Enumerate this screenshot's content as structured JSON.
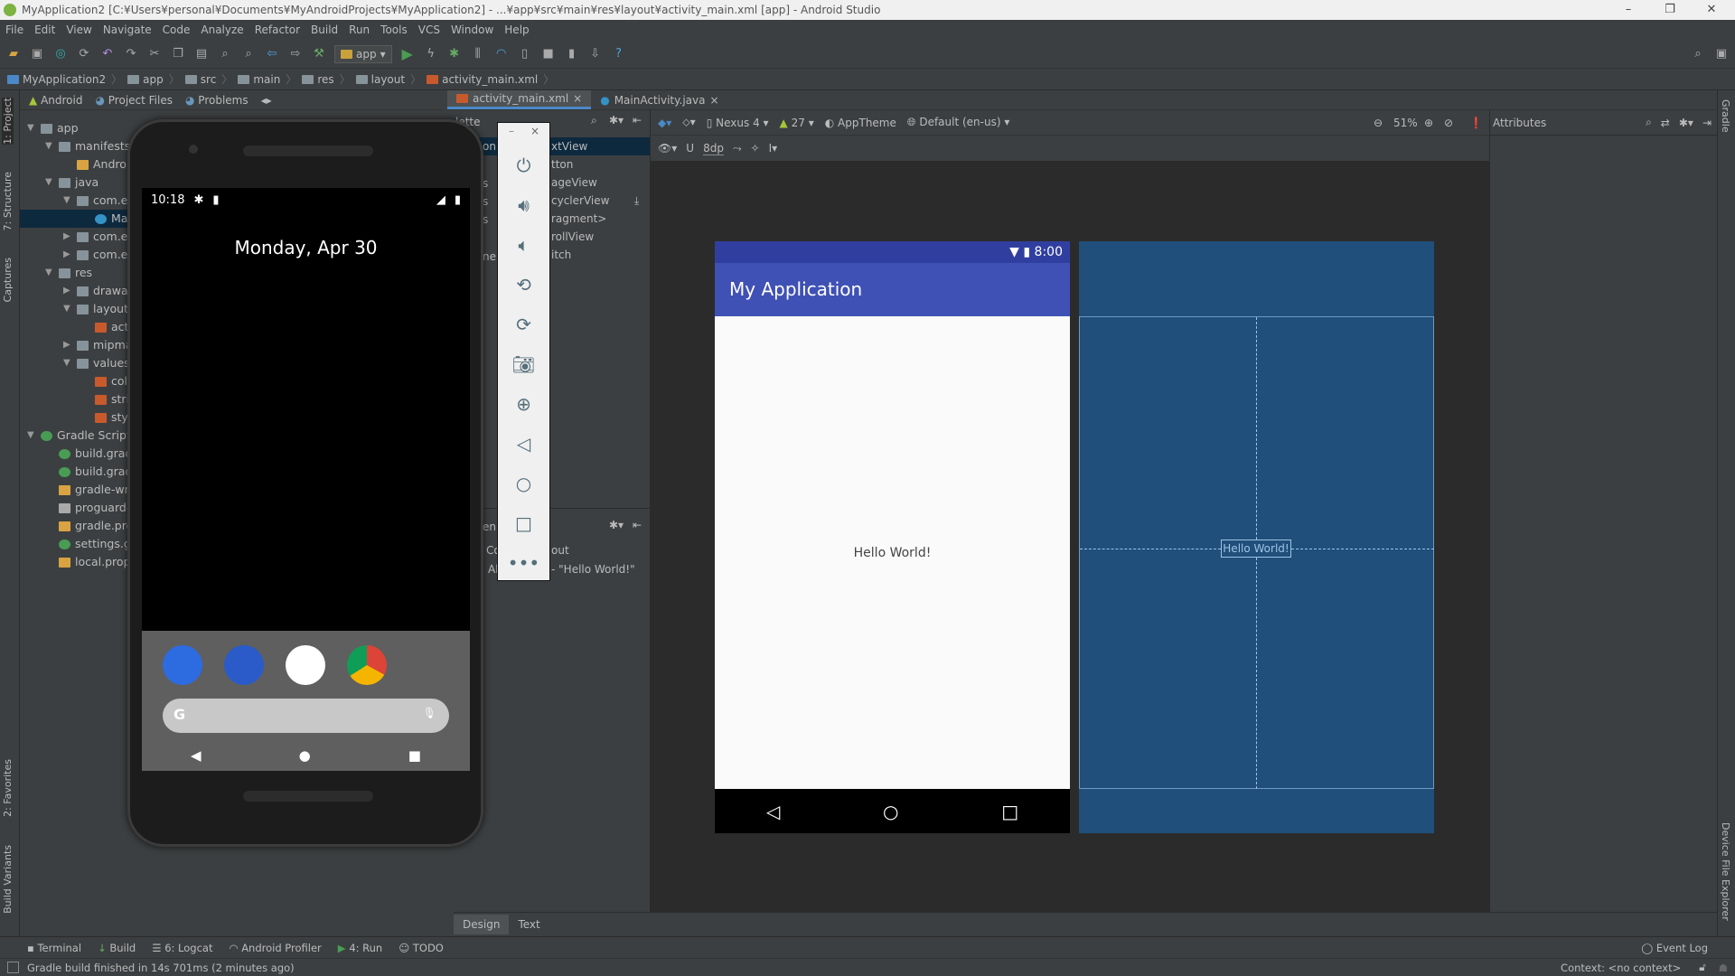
{
  "window": {
    "title": "MyApplication2 [C:¥Users¥personal¥Documents¥MyAndroidProjects¥MyApplication2] - ...¥app¥src¥main¥res¥layout¥activity_main.xml [app] - Android Studio",
    "minimize": "–",
    "maximize": "❐",
    "close": "✕"
  },
  "menu": [
    "File",
    "Edit",
    "View",
    "Navigate",
    "Code",
    "Analyze",
    "Refactor",
    "Build",
    "Run",
    "Tools",
    "VCS",
    "Window",
    "Help"
  ],
  "toolbar": {
    "run_config": "app"
  },
  "breadcrumb": [
    "MyApplication2",
    "app",
    "src",
    "main",
    "res",
    "layout",
    "activity_main.xml"
  ],
  "left_strip": [
    "1: Project",
    "7: Structure",
    "Captures",
    "2: Favorites",
    "Build Variants"
  ],
  "right_strip": [
    "Gradle",
    "Device File Explorer"
  ],
  "project_panel": {
    "tabs": [
      "Android",
      "Project Files",
      "Problems"
    ],
    "tree": [
      {
        "label": "app",
        "level": 0,
        "arrow": "▼",
        "icon": "module"
      },
      {
        "label": "manifests",
        "level": 1,
        "arrow": "▼",
        "icon": "folder"
      },
      {
        "label": "Androi",
        "level": 2,
        "arrow": "",
        "icon": "manifest"
      },
      {
        "label": "java",
        "level": 1,
        "arrow": "▼",
        "icon": "folder"
      },
      {
        "label": "com.ex",
        "level": 2,
        "arrow": "▼",
        "icon": "package"
      },
      {
        "label": "Ma",
        "level": 3,
        "arrow": "",
        "icon": "class",
        "selected": true
      },
      {
        "label": "com.ex",
        "level": 2,
        "arrow": "▶",
        "icon": "package"
      },
      {
        "label": "com.ex",
        "level": 2,
        "arrow": "▶",
        "icon": "package"
      },
      {
        "label": "res",
        "level": 1,
        "arrow": "▼",
        "icon": "res-folder"
      },
      {
        "label": "drawab",
        "level": 2,
        "arrow": "▶",
        "icon": "folder"
      },
      {
        "label": "layout",
        "level": 2,
        "arrow": "▼",
        "icon": "folder"
      },
      {
        "label": "act",
        "level": 3,
        "arrow": "",
        "icon": "xml"
      },
      {
        "label": "mipma",
        "level": 2,
        "arrow": "▶",
        "icon": "folder"
      },
      {
        "label": "values",
        "level": 2,
        "arrow": "▼",
        "icon": "folder"
      },
      {
        "label": "col",
        "level": 3,
        "arrow": "",
        "icon": "xml"
      },
      {
        "label": "stri",
        "level": 3,
        "arrow": "",
        "icon": "xml"
      },
      {
        "label": "styl",
        "level": 3,
        "arrow": "",
        "icon": "xml"
      },
      {
        "label": "Gradle Scripts",
        "level": 0,
        "arrow": "▼",
        "icon": "gradle"
      },
      {
        "label": "build.gradl",
        "level": 1,
        "arrow": "",
        "icon": "gradle"
      },
      {
        "label": "build.gradl",
        "level": 1,
        "arrow": "",
        "icon": "gradle"
      },
      {
        "label": "gradle-wra",
        "level": 1,
        "arrow": "",
        "icon": "properties"
      },
      {
        "label": "proguard-r",
        "level": 1,
        "arrow": "",
        "icon": "text"
      },
      {
        "label": "gradle.prop",
        "level": 1,
        "arrow": "",
        "icon": "properties"
      },
      {
        "label": "settings.gra",
        "level": 1,
        "arrow": "",
        "icon": "gradle"
      },
      {
        "label": "local.prope",
        "level": 1,
        "arrow": "",
        "icon": "properties"
      }
    ]
  },
  "editor_tabs": [
    {
      "label": "activity_main.xml",
      "active": true
    },
    {
      "label": "MainActivity.java",
      "active": false
    }
  ],
  "palette": {
    "title": "lette",
    "category": "on",
    "items": [
      "xtView",
      "tton",
      "ageView",
      "cyclerView",
      "ragment>",
      "rollView",
      "itch"
    ],
    "partial_categories": [
      "s",
      "s",
      "s",
      "ner"
    ],
    "tree_header": "en",
    "tree_items": [
      "out",
      "- \"Hello World!\""
    ],
    "tree_prefix": [
      "Co",
      "Al"
    ]
  },
  "design_toolbar": {
    "device": "Nexus 4",
    "api": "27",
    "theme": "AppTheme",
    "locale": "Default (en-us)",
    "zoom": "51%",
    "margin": "8dp"
  },
  "attributes": {
    "title": "Attributes"
  },
  "preview": {
    "status_time": "8:00",
    "app_title": "My Application",
    "content": "Hello World!",
    "blueprint_label": "Hello World!"
  },
  "emulator": {
    "time": "10:18",
    "date": "Monday, Apr 30",
    "side_controls": [
      "power",
      "volume-up",
      "volume-down",
      "rotate-left",
      "rotate-right",
      "screenshot",
      "zoom",
      "back",
      "home",
      "overview",
      "more"
    ]
  },
  "design_tabs": [
    "Design",
    "Text"
  ],
  "bottom_tools": [
    "Terminal",
    "Build",
    "6: Logcat",
    "Android Profiler",
    "4: Run",
    "TODO"
  ],
  "event_log": "Event Log",
  "status": {
    "message": "Gradle build finished in 14s 701ms (2 minutes ago)",
    "context": "Context: <no context>"
  },
  "colors": {
    "primary": "#3f51b5",
    "primary_dark": "#303f9f",
    "blueprint": "#1f4f7a",
    "ide_bg": "#3c3f41"
  }
}
